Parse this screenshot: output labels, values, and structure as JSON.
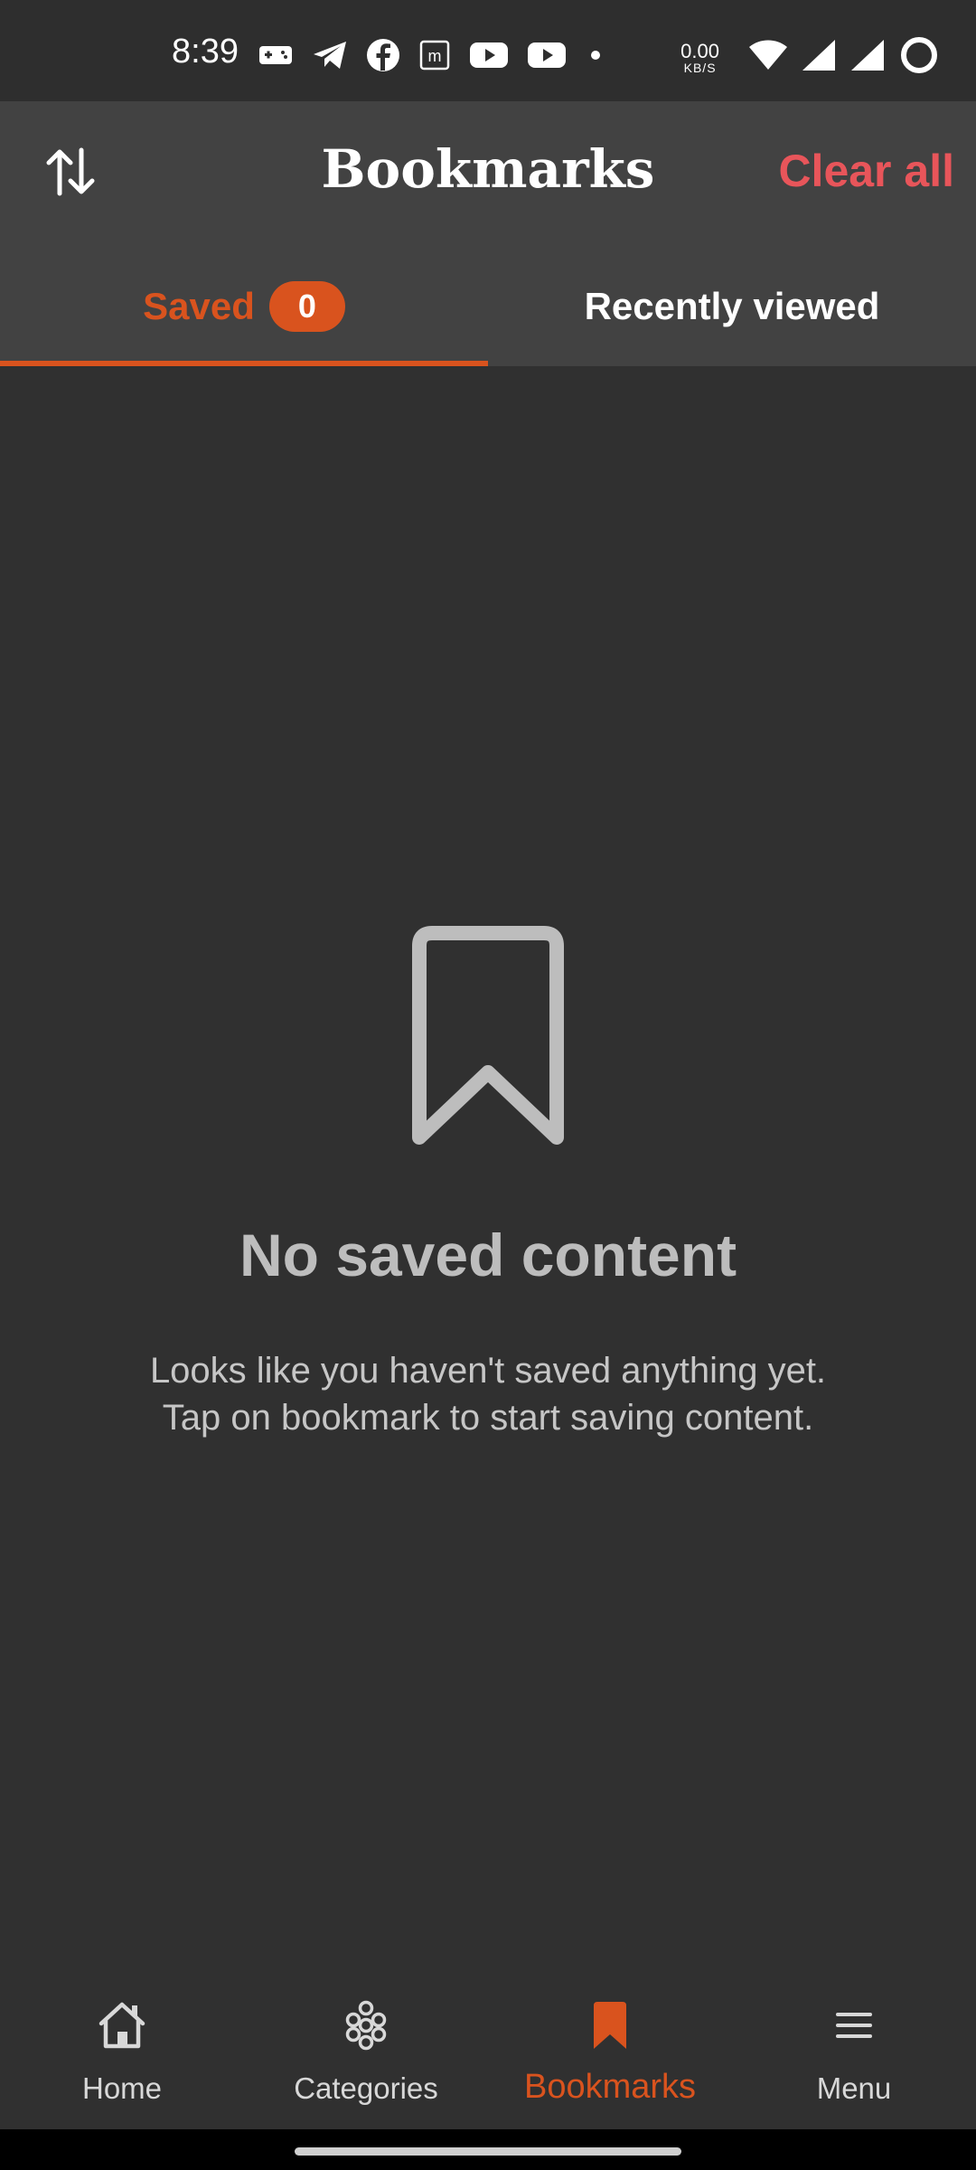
{
  "status_bar": {
    "time": "8:39",
    "net_speed_value": "0.00",
    "net_speed_unit": "KB/S",
    "icons": [
      "gamepad-icon",
      "telegram-icon",
      "facebook-icon",
      "m-app-icon",
      "youtube-icon",
      "youtube-icon",
      "dot-icon",
      "wifi-icon",
      "signal-icon",
      "signal-icon",
      "battery-ring-icon"
    ]
  },
  "header": {
    "title": "Bookmarks",
    "clear_all_label": "Clear all",
    "sort_icon": "sort-arrows-icon"
  },
  "tabs": [
    {
      "label": "Saved",
      "badge": "0",
      "active": true
    },
    {
      "label": "Recently viewed",
      "active": false
    }
  ],
  "empty_state": {
    "icon": "bookmark-outline-icon",
    "title": "No saved content",
    "description_line1": "Looks like you haven't saved anything yet.",
    "description_line2": "Tap on bookmark to start saving content."
  },
  "bottom_nav": [
    {
      "label": "Home",
      "icon": "home-icon"
    },
    {
      "label": "Categories",
      "icon": "categories-icon"
    },
    {
      "label": "Bookmarks",
      "icon": "bookmark-filled-icon",
      "active": true
    },
    {
      "label": "Menu",
      "icon": "menu-icon"
    }
  ],
  "colors": {
    "accent": "#d9531e",
    "clear_all": "#e8555a",
    "background": "#303030",
    "header_bg": "#424242"
  }
}
